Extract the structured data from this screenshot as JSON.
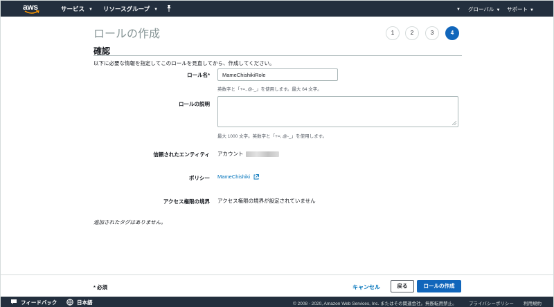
{
  "header": {
    "logo_text": "aws",
    "services_label": "サービス",
    "resource_groups_label": "リソースグループ",
    "region_label": "グローバル",
    "support_label": "サポート"
  },
  "wizard": {
    "title": "ロールの作成",
    "steps": [
      "1",
      "2",
      "3",
      "4"
    ],
    "active_step": 4
  },
  "review": {
    "section_title": "確認",
    "intro": "以下に必要な情報を指定してこのロールを見直してから、作成してください。",
    "role_name_label": "ロール名*",
    "role_name_value": "MameChishikiRole",
    "role_name_hint": "英数字と「+=,.@-_」を使用します。最大 64 文字。",
    "description_label": "ロールの説明",
    "description_value": "",
    "description_hint": "最大 1000 文字。英数字と「+=,.@-_」を使用します。",
    "trusted_entity_label": "信頼されたエンティティ",
    "trusted_entity_value": "アカウント",
    "policy_label": "ポリシー",
    "policy_value": "MameChishiki",
    "boundary_label": "アクセス権限の境界",
    "boundary_value": "アクセス権限の境界が設定されていません",
    "tags_note": "追加されたタグはありません。"
  },
  "actions": {
    "required_note": "* 必須",
    "cancel_label": "キャンセル",
    "back_label": "戻る",
    "create_label": "ロールの作成"
  },
  "footer": {
    "feedback_label": "フィードバック",
    "language_label": "日本語",
    "copyright": "© 2008 - 2020, Amazon Web Services, Inc. またはその関連会社。無断転用禁止。",
    "privacy_label": "プライバシーポリシー",
    "terms_label": "利用規約"
  },
  "colors": {
    "nav_bg": "#232f3e",
    "primary": "#1166bb",
    "link": "#0073bb"
  }
}
